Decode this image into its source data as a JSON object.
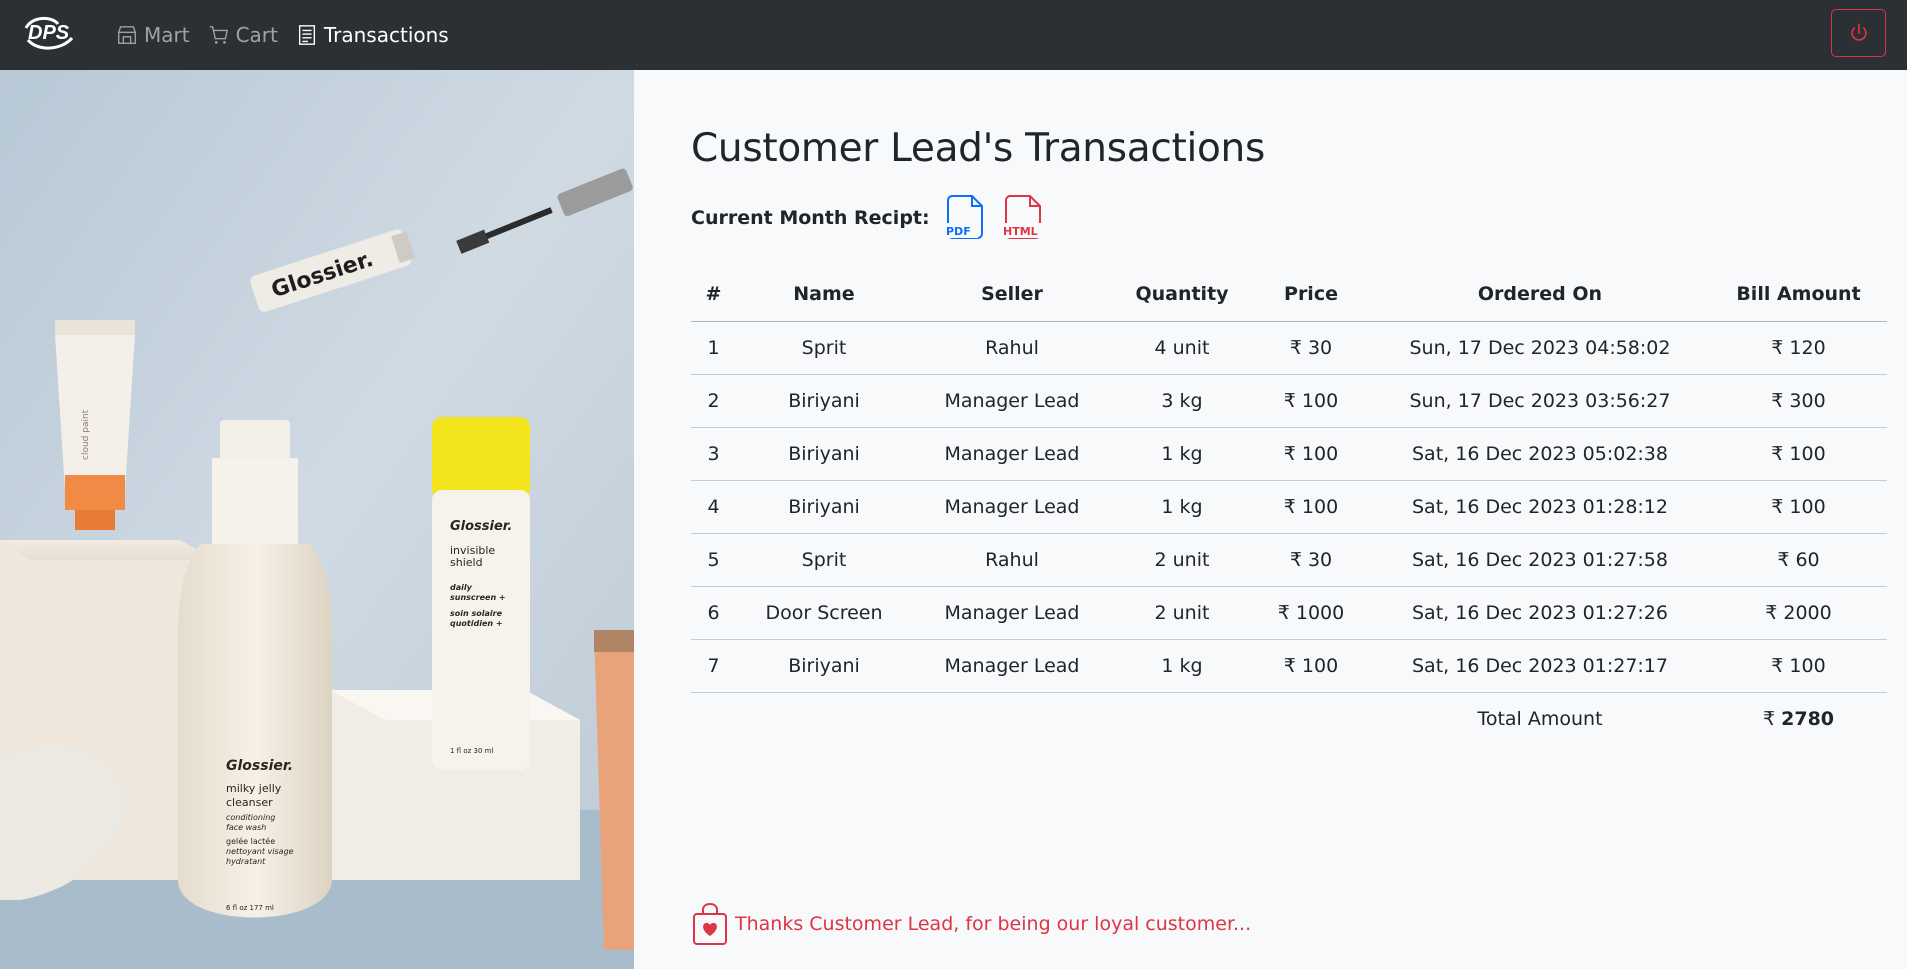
{
  "navbar": {
    "brand": "DPS",
    "links": [
      {
        "label": "Mart",
        "icon": "shop-icon"
      },
      {
        "label": "Cart",
        "icon": "cart-icon"
      },
      {
        "label": "Transactions",
        "icon": "receipt-icon",
        "active": true
      }
    ],
    "logout_icon": "power-icon"
  },
  "hero": {
    "brand_text": "Glossier.",
    "products": {
      "tube_left": "cloud paint",
      "bottle_name": "milky jelly",
      "bottle_line2": "cleanser",
      "bottle_sub1": "conditioning",
      "bottle_sub2": "face wash",
      "bottle_fr1": "gelée lactée",
      "bottle_fr2": "nettoyant visage",
      "bottle_fr3": "hydratant",
      "bottle_size": "6 fl oz  177 ml",
      "stick_name1": "invisible",
      "stick_name2": "shield",
      "stick_sub1": "daily",
      "stick_sub2": "sunscreen +",
      "stick_fr1": "soin solaire",
      "stick_fr2": "quotidien +",
      "stick_size": "1 fl oz  30 ml"
    }
  },
  "main": {
    "title": "Customer Lead's Transactions",
    "recipt_label": "Current Month Recipt:",
    "pdf_label": "PDF",
    "html_label": "HTML",
    "columns": [
      "#",
      "Name",
      "Seller",
      "Quantity",
      "Price",
      "Ordered On",
      "Bill Amount"
    ],
    "rows": [
      {
        "idx": "1",
        "name": "Sprit",
        "seller": "Rahul",
        "qty": "4 unit",
        "price": "₹ 30",
        "date": "Sun, 17 Dec 2023 04:58:02",
        "bill": "₹ 120"
      },
      {
        "idx": "2",
        "name": "Biriyani",
        "seller": "Manager Lead",
        "qty": "3 kg",
        "price": "₹ 100",
        "date": "Sun, 17 Dec 2023 03:56:27",
        "bill": "₹ 300"
      },
      {
        "idx": "3",
        "name": "Biriyani",
        "seller": "Manager Lead",
        "qty": "1 kg",
        "price": "₹ 100",
        "date": "Sat, 16 Dec 2023 05:02:38",
        "bill": "₹ 100"
      },
      {
        "idx": "4",
        "name": "Biriyani",
        "seller": "Manager Lead",
        "qty": "1 kg",
        "price": "₹ 100",
        "date": "Sat, 16 Dec 2023 01:28:12",
        "bill": "₹ 100"
      },
      {
        "idx": "5",
        "name": "Sprit",
        "seller": "Rahul",
        "qty": "2 unit",
        "price": "₹ 30",
        "date": "Sat, 16 Dec 2023 01:27:58",
        "bill": "₹ 60"
      },
      {
        "idx": "6",
        "name": "Door Screen",
        "seller": "Manager Lead",
        "qty": "2 unit",
        "price": "₹ 1000",
        "date": "Sat, 16 Dec 2023 01:27:26",
        "bill": "₹ 2000"
      },
      {
        "idx": "7",
        "name": "Biriyani",
        "seller": "Manager Lead",
        "qty": "1 kg",
        "price": "₹ 100",
        "date": "Sat, 16 Dec 2023 01:27:17",
        "bill": "₹ 100"
      }
    ],
    "total_label": "Total Amount",
    "total_currency": "₹",
    "total_value": "2780",
    "thanks": "Thanks Customer Lead, for being our loyal customer..."
  },
  "colors": {
    "navbar_bg": "#2b3035",
    "danger": "#dc3545",
    "primary": "#0d6efd"
  }
}
